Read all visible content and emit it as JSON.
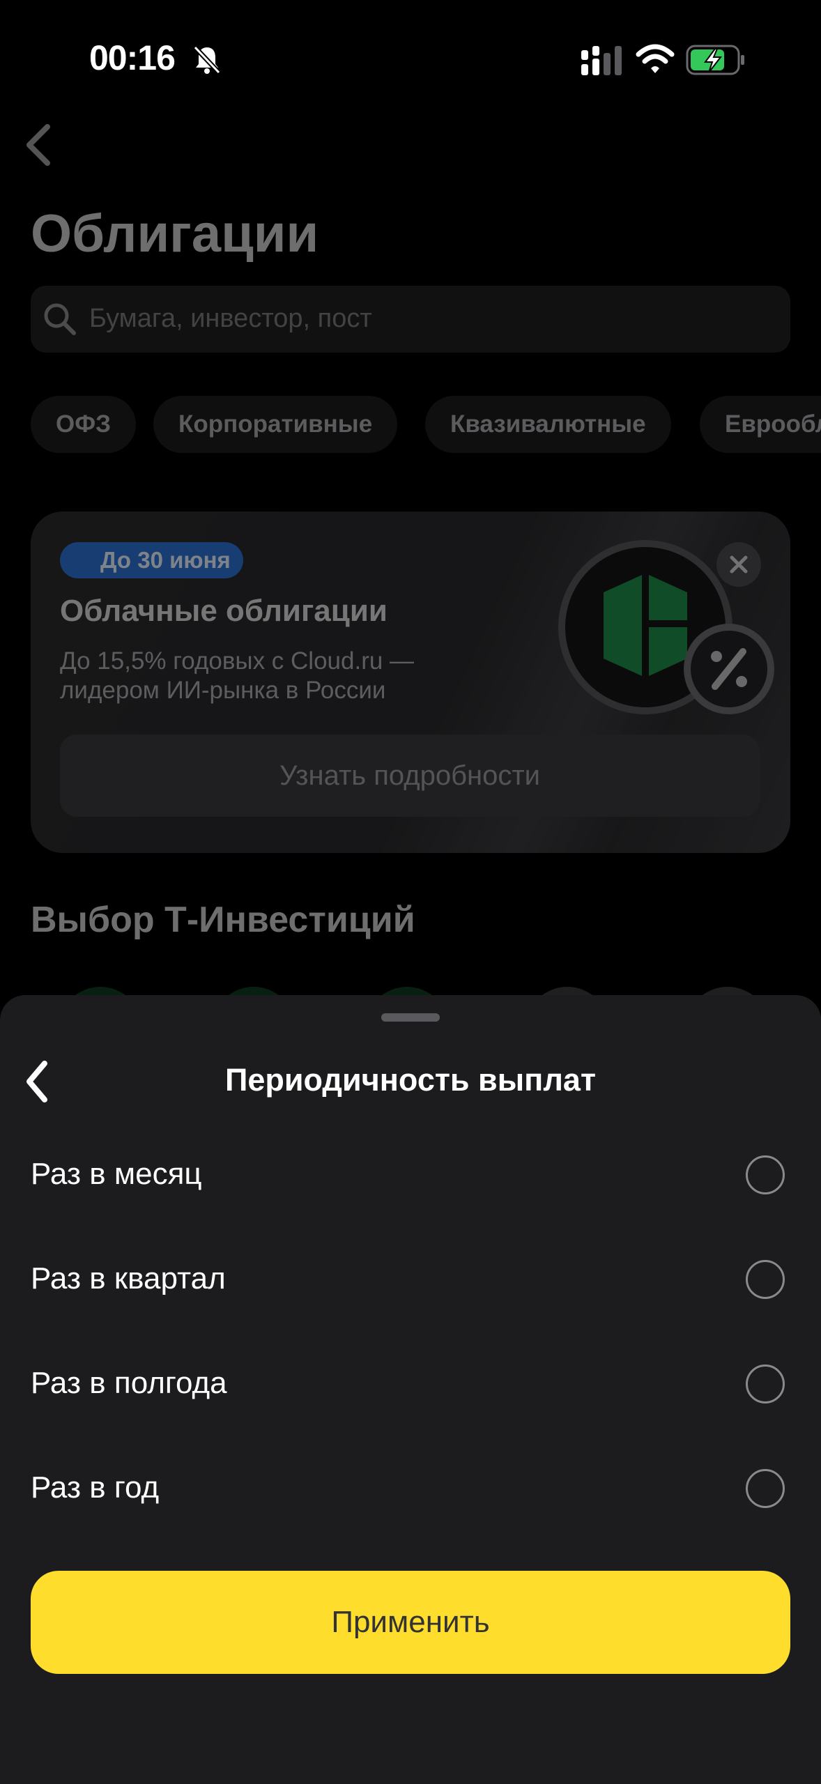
{
  "status_bar": {
    "time": "00:16",
    "icons": [
      "bell-muted-icon",
      "cellular-signal-icon",
      "wifi-icon",
      "battery-charging-icon"
    ],
    "battery_color": "#34c759"
  },
  "header": {
    "back_icon": "chevron-left-icon",
    "title": "Облигации"
  },
  "search": {
    "placeholder": "Бумага, инвестор, пост",
    "icon": "search-icon"
  },
  "filter_chips": [
    "ОФЗ",
    "Корпоративные",
    "Квазивалютные",
    "Еврообл"
  ],
  "promo": {
    "badge": "До 30 июня",
    "title": "Облачные облигации",
    "subtitle": "До 15,5% годовых с Cloud.ru — лидером ИИ-рынка в России",
    "button": "Узнать подробности",
    "badge_color": "#2d6fd0",
    "close_icon": "close-icon"
  },
  "section": {
    "title": "Выбор Т-Инвестиций"
  },
  "sheet": {
    "title": "Периодичность выплат",
    "back_icon": "chevron-left-icon",
    "options": [
      {
        "label": "Раз в месяц",
        "selected": false
      },
      {
        "label": "Раз в квартал",
        "selected": false
      },
      {
        "label": "Раз в полгода",
        "selected": false
      },
      {
        "label": "Раз в год",
        "selected": false
      }
    ],
    "apply_button": "Применить",
    "accent_color": "#ffdd2d"
  }
}
